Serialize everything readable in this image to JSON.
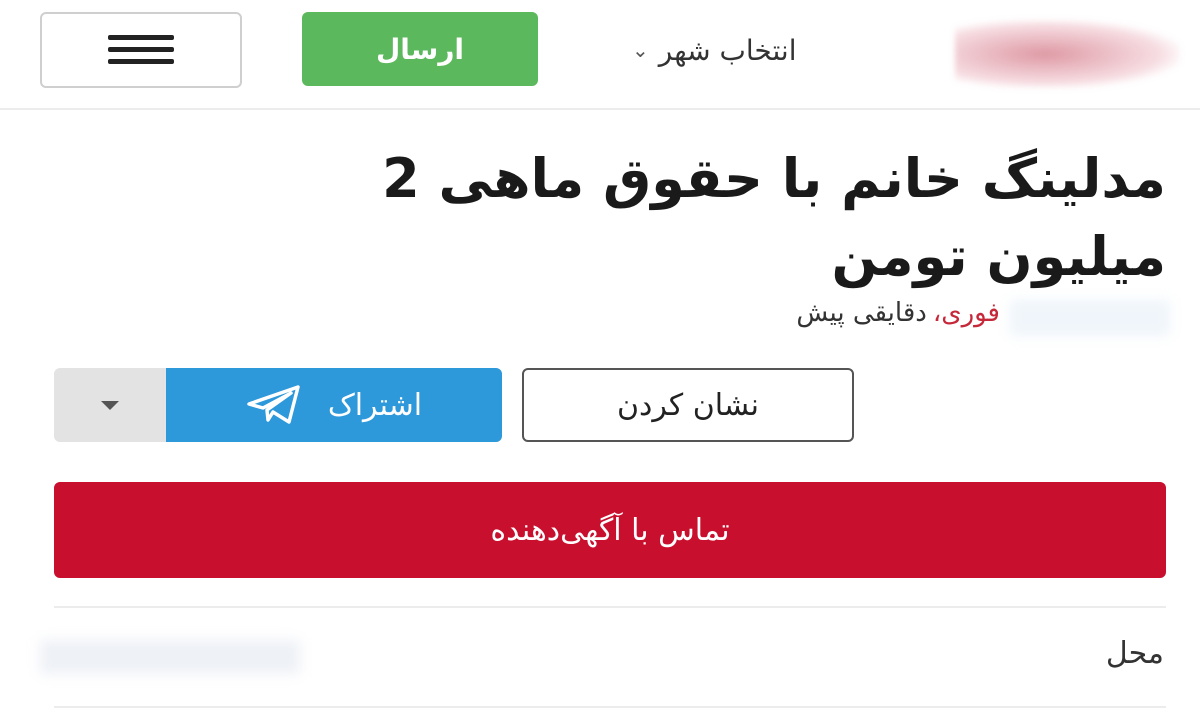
{
  "header": {
    "send_label": "ارسال",
    "city_label": "انتخاب شهر"
  },
  "listing": {
    "title_line1": "مدلینگ خانم با حقوق ماهی 2",
    "title_line2": "میلیون تومن",
    "urgent_tag": "فوری،",
    "time_ago": "دقایقی پیش"
  },
  "actions": {
    "share_label": "اشتراک",
    "bookmark_label": "نشان کردن",
    "contact_label": "تماس با آگهی‌دهنده"
  },
  "details": {
    "location_label": "محل"
  },
  "colors": {
    "send": "#5cb85c",
    "share": "#2d98da",
    "contact": "#c8102e",
    "urgent": "#c62839"
  }
}
